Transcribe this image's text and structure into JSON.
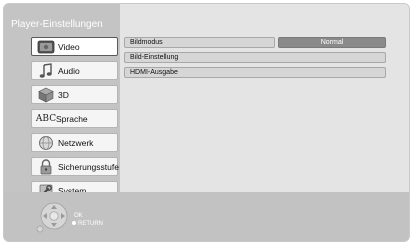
{
  "header": {
    "title": "Player-Einstellungen"
  },
  "menu": {
    "items": [
      {
        "label": "Video",
        "icon": "video-icon",
        "selected": true
      },
      {
        "label": "Audio",
        "icon": "audio-icon",
        "selected": false
      },
      {
        "label": "3D",
        "icon": "3d-cube-icon",
        "selected": false
      },
      {
        "label": "Sprache",
        "icon": "language-abc-icon",
        "icon_text": "ABC",
        "selected": false
      },
      {
        "label": "Netzwerk",
        "icon": "network-globe-icon",
        "selected": false
      },
      {
        "label": "Sicherungsstufe",
        "icon": "lock-icon",
        "selected": false
      },
      {
        "label": "System",
        "icon": "system-wrench-icon",
        "selected": false
      }
    ]
  },
  "settings": {
    "rows": [
      {
        "label": "Bildmodus",
        "value": "Normal"
      },
      {
        "label": "Bild-Einstellung"
      },
      {
        "label": "HDMI-Ausgabe"
      }
    ]
  },
  "footer": {
    "ok_label": "OK",
    "return_label": "RETURN"
  },
  "colors": {
    "panel_dark": "#c4c4c4",
    "panel_light": "#e4e4e4",
    "value_bg": "#8a8a8a",
    "title_text": "#ffffff"
  }
}
